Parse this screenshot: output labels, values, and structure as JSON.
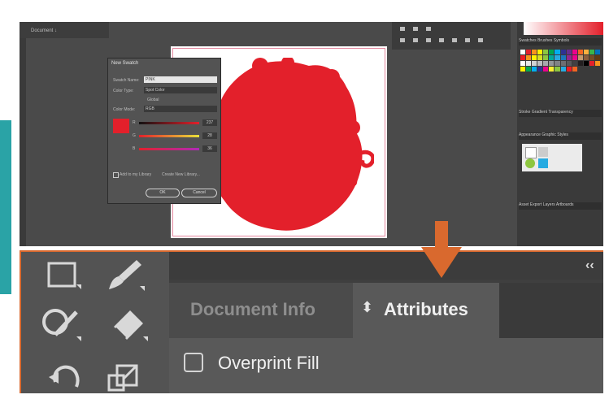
{
  "top_screenshot": {
    "left_panel_label": "Document ↓",
    "search_dialog": {
      "title": "New Swatch",
      "name_label": "Swatch Name:",
      "name_value": "PINK",
      "color_type_label": "Color Type:",
      "color_type_value": "Spot Color",
      "global_label": "Global",
      "color_mode_label": "Color Mode:",
      "color_mode_value": "RGB",
      "channels": [
        {
          "label": "R",
          "value": "237"
        },
        {
          "label": "G",
          "value": "28"
        },
        {
          "label": "B",
          "value": "36"
        }
      ],
      "add_to_library_label": "Add to my Library",
      "library_value": "Create New Library...",
      "ok_label": "OK",
      "cancel_label": "Cancel"
    },
    "right_panel": {
      "tabs_label": "Swatches  Brushes  Symbols",
      "stroke_tabs_label": "Stroke  Gradient  Transparency",
      "appearance_tabs_label": "Appearance  Graphic Styles",
      "layers_tabs_label": "Asset Export  Layers  Artboards"
    },
    "colors": {
      "accent_red": "#e3202b",
      "teal": "#2aa3a6",
      "arrow_orange": "#d9692e"
    }
  },
  "bottom_screenshot": {
    "collapse_glyph": "‹‹",
    "tabs": [
      {
        "label": "Document Info",
        "active": false
      },
      {
        "label": "Attributes",
        "active": true,
        "icon": "updown-icon"
      }
    ],
    "attributes": {
      "overprint_fill_label": "Overprint Fill",
      "overprint_fill_checked": false
    },
    "tools": [
      "rectangle-tool-icon",
      "paintbrush-tool-icon",
      "shaper-tool-icon",
      "eraser-tool-icon",
      "rotate-tool-icon",
      "scale-tool-icon"
    ]
  }
}
